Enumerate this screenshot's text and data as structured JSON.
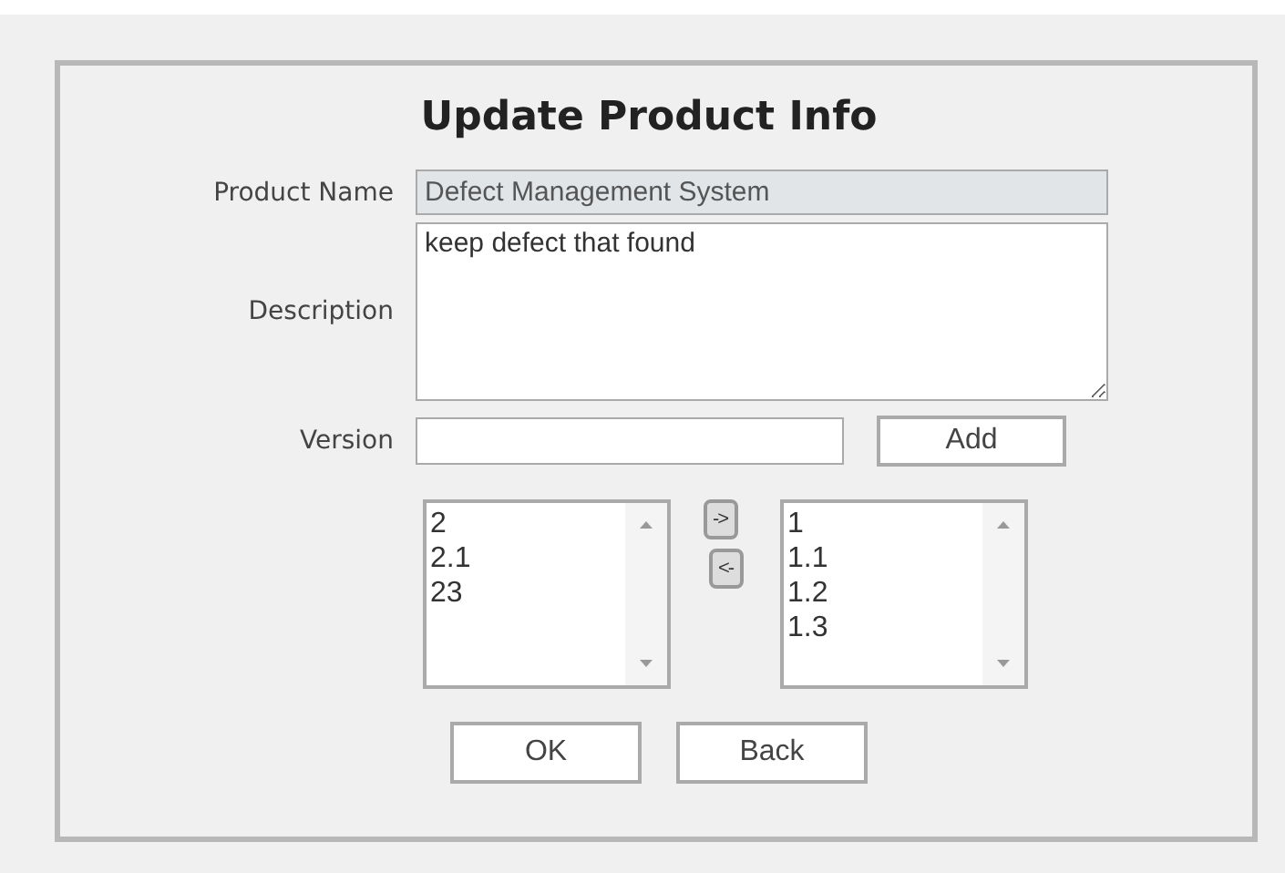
{
  "title": "Update Product Info",
  "product_name": {
    "label": "Product Name",
    "value": "Defect Management System",
    "disabled": true
  },
  "description": {
    "label": "Description",
    "value": "keep defect that found"
  },
  "version": {
    "label": "Version",
    "add_button": "Add"
  },
  "available_versions": [
    "2",
    "2.1",
    "23"
  ],
  "move_buttons": [
    {
      "label": "->"
    },
    {
      "label": "<-"
    }
  ],
  "selected_versions": [
    "1",
    "1.1",
    "1.2",
    "1.3"
  ],
  "buttons": [
    "OK",
    "Back"
  ]
}
